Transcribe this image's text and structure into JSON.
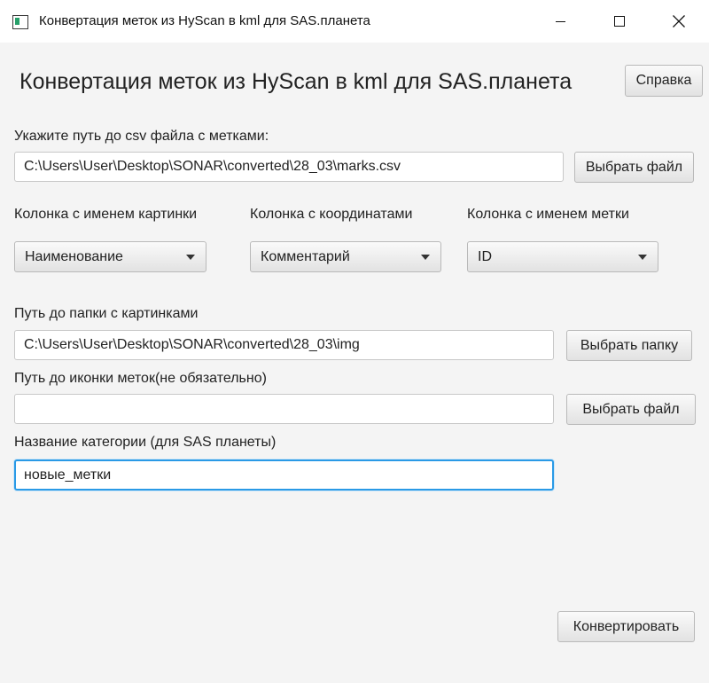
{
  "window": {
    "title": "Конвертация меток из HyScan в kml для SAS.планета"
  },
  "header": {
    "heading": "Конвертация меток из HyScan в kml для SAS.планета",
    "help_button": "Справка"
  },
  "csv": {
    "label": "Укажите путь до csv файла с метками:",
    "value": "C:\\Users\\User\\Desktop\\SONAR\\converted\\28_03\\marks.csv",
    "button": "Выбрать файл"
  },
  "columns": {
    "image": {
      "label": "Колонка с именем картинки",
      "selected": "Наименование"
    },
    "coords": {
      "label": "Колонка с координатами",
      "selected": "Комментарий"
    },
    "mark": {
      "label": "Колонка с именем метки",
      "selected": "ID"
    }
  },
  "images_folder": {
    "label": "Путь до папки с картинками",
    "value": "C:\\Users\\User\\Desktop\\SONAR\\converted\\28_03\\img",
    "button": "Выбрать папку"
  },
  "icon": {
    "label": "Путь до иконки меток(не обязательно)",
    "value": "",
    "button": "Выбрать файл"
  },
  "category": {
    "label": "Название категории (для SAS планеты)",
    "value": "новые_метки"
  },
  "actions": {
    "convert_button": "Конвертировать"
  }
}
